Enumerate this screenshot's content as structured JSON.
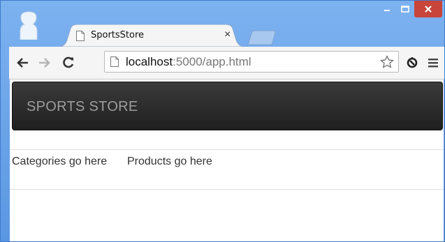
{
  "browser": {
    "tab": {
      "title": "SportsStore",
      "close_glyph": "×"
    },
    "address_bar": {
      "host": "localhost",
      "path": ":5000/app.html"
    },
    "icons": [
      "profile-icon",
      "page-favicon-icon",
      "close-icon",
      "new-tab-button",
      "minimize-icon",
      "maximize-icon",
      "window-close-icon",
      "back-arrow-icon",
      "forward-arrow-icon",
      "reload-icon",
      "page-icon",
      "star-icon",
      "extension-icon",
      "menu-icon"
    ],
    "colors": {
      "frame": "#5a97e2",
      "close_button": "#c7453a"
    }
  },
  "page": {
    "brand": "SPORTS STORE",
    "categories_placeholder": "Categories go here",
    "products_placeholder": "Products go here",
    "colors": {
      "navbar": "#222222",
      "brand_text": "#9d9d9d"
    }
  }
}
